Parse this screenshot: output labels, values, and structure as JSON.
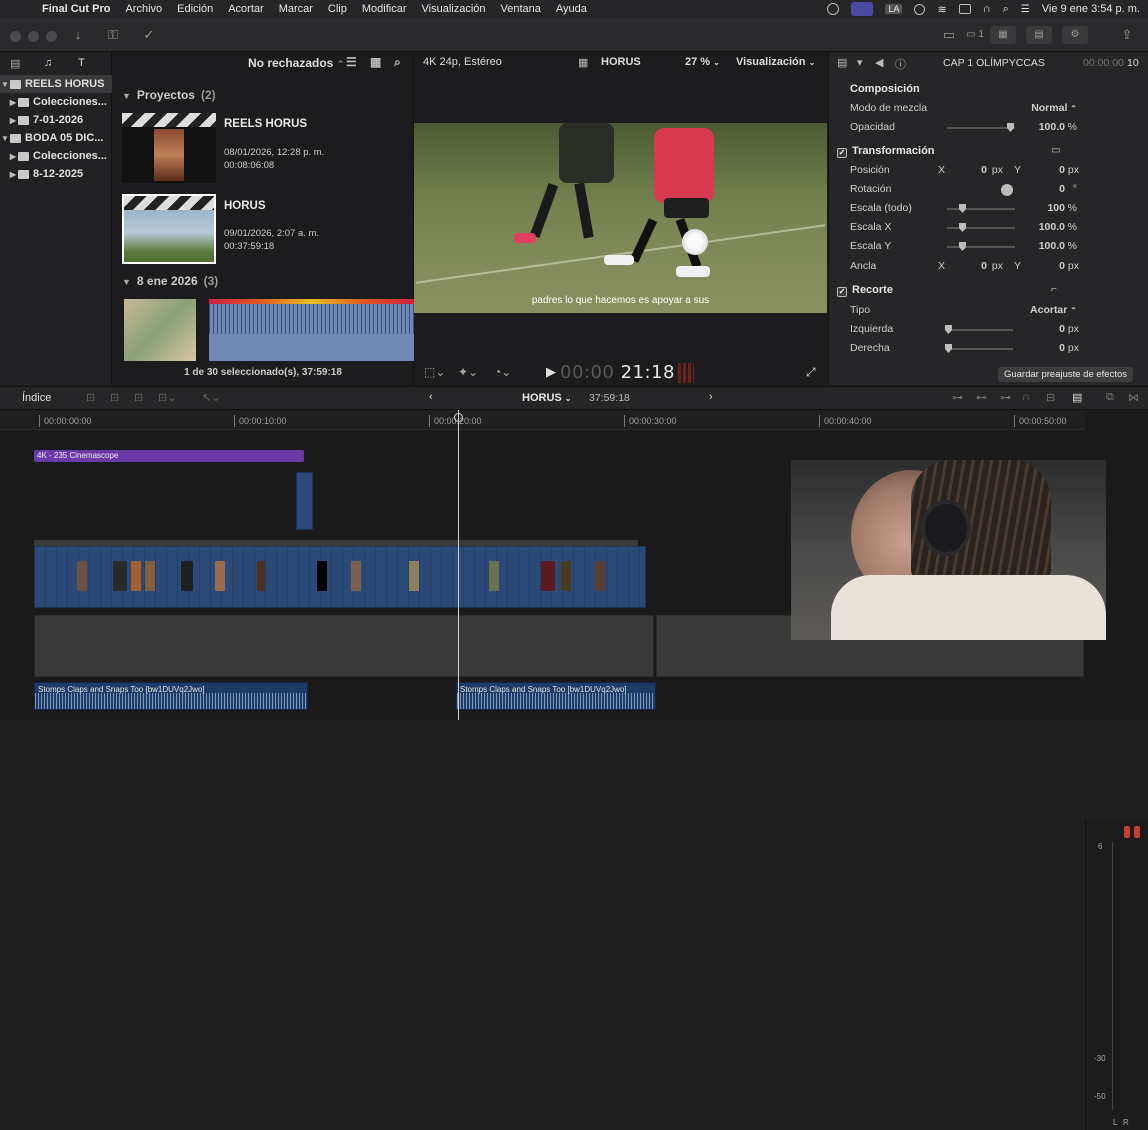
{
  "menubar": {
    "app": "Final Cut Pro",
    "items": [
      "Archivo",
      "Edición",
      "Acortar",
      "Marcar",
      "Clip",
      "Modificar",
      "Visualización",
      "Ventana",
      "Ayuda"
    ],
    "clock": "Vie 9 ene  3:54 p. m.",
    "input_source": "LA"
  },
  "browser": {
    "filter": "No rechazados",
    "libraries": [
      {
        "label": "REELS HORUS",
        "level": 0,
        "expanded": true,
        "selected": true
      },
      {
        "label": "Colecciones...",
        "level": 1,
        "expanded": false
      },
      {
        "label": "7-01-2026",
        "level": 1,
        "expanded": false
      },
      {
        "label": "BODA 05 DIC...",
        "level": 0,
        "expanded": true
      },
      {
        "label": "Colecciones...",
        "level": 1,
        "expanded": false
      },
      {
        "label": "8-12-2025",
        "level": 1,
        "expanded": false
      }
    ],
    "sections": [
      {
        "title": "Proyectos",
        "count": "(2)"
      },
      {
        "title": "8 ene 2026",
        "count": "(3)"
      }
    ],
    "projects": [
      {
        "name": "REELS HORUS",
        "date": "08/01/2026, 12:28 p. m.",
        "duration": "00:08:06:08"
      },
      {
        "name": "HORUS",
        "date": "09/01/2026, 2:07 a. m.",
        "duration": "00:37:59:18"
      }
    ],
    "status": "1 de 30 seleccionado(s), 37:59:18"
  },
  "viewer": {
    "format": "4K 24p, Estéreo",
    "project": "HORUS",
    "zoom": "27 %",
    "view_menu": "Visualización",
    "subtitle": "padres lo que hacemos es apoyar a sus",
    "timecode_dim": "00:00",
    "timecode": "21:18"
  },
  "inspector": {
    "title": "CAP 1 OLÍMPYCCAS",
    "time": "00:00:00",
    "frames": "10",
    "composition": {
      "heading": "Composición",
      "blend_label": "Modo de mezcla",
      "blend_value": "Normal",
      "opacity_label": "Opacidad",
      "opacity_value": "100.0",
      "opacity_unit": "%"
    },
    "transform": {
      "heading": "Transformación",
      "position_label": "Posición",
      "pos_x": "0",
      "pos_y": "0",
      "rotation_label": "Rotación",
      "rotation_value": "0",
      "rotation_unit": "°",
      "scale_all_label": "Escala (todo)",
      "scale_all": "100",
      "scale_x_label": "Escala X",
      "scale_x": "100.0",
      "scale_y_label": "Escala Y",
      "scale_y": "100.0",
      "anchor_label": "Ancla",
      "anchor_x": "0",
      "anchor_y": "0"
    },
    "crop": {
      "heading": "Recorte",
      "type_label": "Tipo",
      "type_value": "Acortar",
      "left_label": "Izquierda",
      "left_value": "0",
      "right_label": "Derecha",
      "right_value": "0"
    },
    "axis_x": "X",
    "axis_y": "Y",
    "unit_px": "px",
    "unit_pct": "%",
    "save_button": "Guardar preajuste de efectos"
  },
  "timeline": {
    "index_label": "Índice",
    "project": "HORUS",
    "duration": "37:59:18",
    "ruler": [
      "00:00:00:00",
      "00:00:10:00",
      "00:00:20:00",
      "00:00:30:00",
      "00:00:40:00",
      "00:00:50:00"
    ],
    "title_clip": "4K - 235 Cinemascope",
    "audio_clip": "Stomps Claps and Snaps Too [bw1DUVq2Jwo]",
    "meter_labels": [
      "6",
      "-30",
      "-50"
    ],
    "meter_channels": [
      "L",
      "R"
    ]
  }
}
